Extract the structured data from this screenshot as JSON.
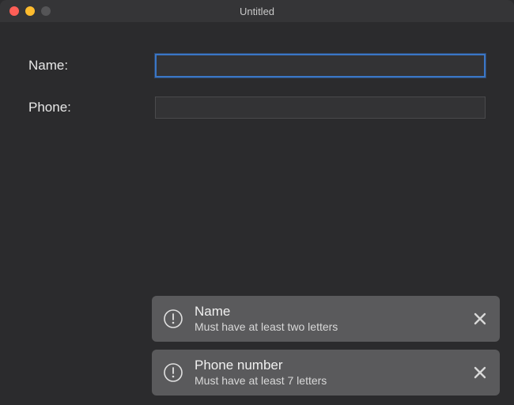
{
  "window": {
    "title": "Untitled"
  },
  "form": {
    "name": {
      "label": "Name:",
      "value": "",
      "focused": true
    },
    "phone": {
      "label": "Phone:",
      "value": "",
      "focused": false
    }
  },
  "notifications": [
    {
      "icon": "alert-circle",
      "title": "Name",
      "message": "Must have at least two letters"
    },
    {
      "icon": "alert-circle",
      "title": "Phone number",
      "message": "Must have at least 7 letters"
    }
  ]
}
